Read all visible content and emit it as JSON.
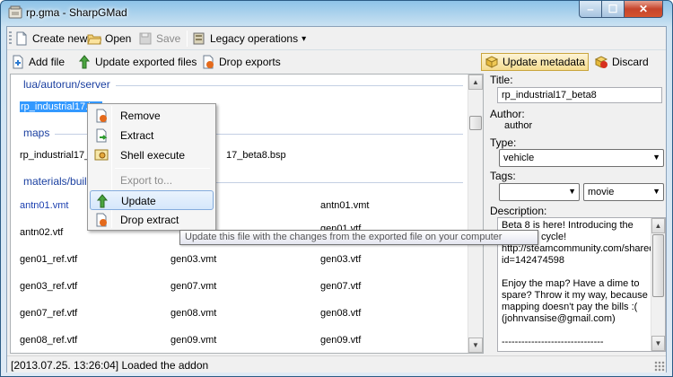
{
  "window": {
    "title": "rp.gma - SharpGMad",
    "min": "‒",
    "max": "☐",
    "close": "✕"
  },
  "toolbar1": {
    "create_new": "Create new",
    "open": "Open",
    "save": "Save",
    "legacy": "Legacy operations",
    "legacy_arrow": "▾"
  },
  "toolbar2": {
    "add_file": "Add file",
    "update_exported": "Update exported files",
    "drop_exports": "Drop exports",
    "update_metadata": "Update metadata",
    "discard": "Discard"
  },
  "files": {
    "groups": [
      {
        "name": "lua/autorun/server"
      },
      {
        "name": "maps"
      },
      {
        "name": "materials/buil"
      }
    ],
    "lua": [
      "rp_industrial17.lua"
    ],
    "maps": [
      "rp_industrial17_b",
      "17_beta8.bsp"
    ],
    "materials_row1": [
      "antn01.vmt",
      "antn01.vmt"
    ],
    "materials_grid": [
      [
        "antn02.vtf",
        "",
        "gen01.vtf"
      ],
      [
        "gen01_ref.vtf",
        "gen03.vmt",
        "gen03.vtf"
      ],
      [
        "gen03_ref.vtf",
        "gen07.vmt",
        "gen07.vtf"
      ],
      [
        "gen07_ref.vtf",
        "gen08.vmt",
        "gen08.vtf"
      ],
      [
        "gen08_ref.vtf",
        "gen09.vmt",
        "gen09.vtf"
      ]
    ]
  },
  "context_menu": {
    "items": [
      {
        "label": "Remove",
        "icon": "remove-icon"
      },
      {
        "label": "Extract",
        "icon": "extract-icon"
      },
      {
        "label": "Shell execute",
        "icon": "shell-execute-icon"
      },
      {
        "label": "Export to...",
        "icon": ""
      },
      {
        "label": "Update",
        "icon": "update-icon"
      },
      {
        "label": "Drop extract",
        "icon": "drop-extract-icon"
      }
    ]
  },
  "tooltip": "Update this file with the changes from the exported file on your computer",
  "metadata": {
    "title_label": "Title:",
    "title_value": "rp_industrial17_beta8",
    "author_label": "Author:",
    "author_value": "author",
    "type_label": "Type:",
    "type_value": "vehicle",
    "tags_label": "Tags:",
    "tag1_value": "",
    "tag2_value": "movie",
    "description_label": "Description:",
    "description_text": "Beta 8 is here! Introducing the new day cycle!\nhttp://steamcommunity.com/sharedfiles/filedetails/?id=142474598\n\nEnjoy the map? Have a dime to spare? Throw it my way, because mapping doesn't pay the bills :(\n(johnvansise@gmail.com)\n\n-------------------------------\n-------------------------------"
  },
  "status": "[2013.07.25. 13:26:04] Loaded the addon",
  "colors": {
    "selection": "#3399ff",
    "group_header": "#1a3fa0",
    "close_button": "#c6452c"
  }
}
